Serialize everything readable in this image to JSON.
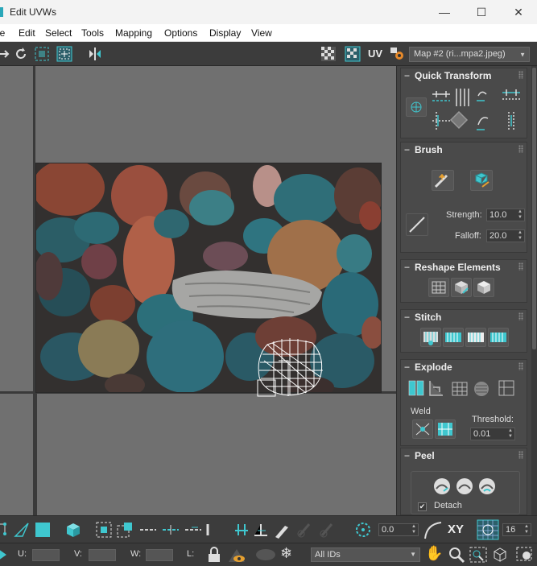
{
  "window": {
    "title": "Edit UVWs",
    "minimize": "—",
    "maximize": "☐",
    "close": "✕"
  },
  "menu": [
    "le",
    "Edit",
    "Select",
    "Tools",
    "Mapping",
    "Options",
    "Display",
    "View"
  ],
  "toolbar": {
    "uv_label": "UV",
    "map_dropdown": "Map #2 (ri...mpa2.jpeg)"
  },
  "panel": {
    "quick_transform": {
      "title": "Quick Transform"
    },
    "brush": {
      "title": "Brush",
      "strength_label": "Strength:",
      "strength_value": "10.0",
      "falloff_label": "Falloff:",
      "falloff_value": "20.0"
    },
    "reshape": {
      "title": "Reshape Elements"
    },
    "stitch": {
      "title": "Stitch"
    },
    "explode": {
      "title": "Explode",
      "weld_label": "Weld",
      "threshold_label": "Threshold:",
      "threshold_value": "0.01"
    },
    "peel": {
      "title": "Peel",
      "detach_label": "Detach",
      "detach_checked": true
    }
  },
  "bottom_bar": {
    "rotation_value": "0.0",
    "xy_label": "XY",
    "grid_value": "16"
  },
  "status_bar": {
    "u_label": "U:",
    "v_label": "V:",
    "w_label": "W:",
    "l_label": "L:",
    "ids_dropdown": "All IDs"
  },
  "colors": {
    "accent": "#3fc7cf",
    "panel_bg": "#444444",
    "viewport_bg": "#707070"
  }
}
